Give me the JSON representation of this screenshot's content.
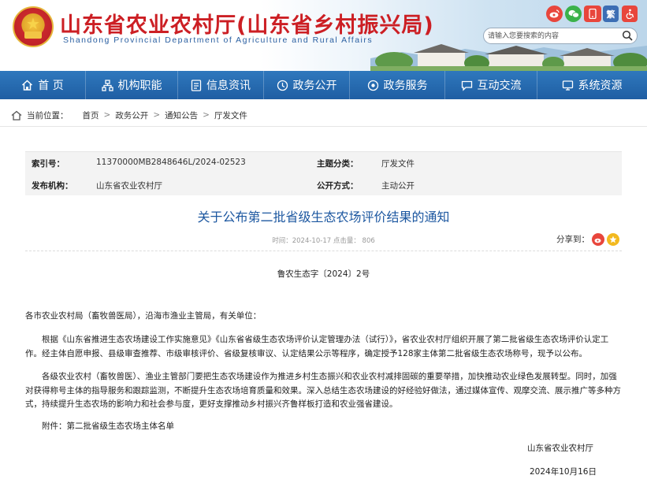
{
  "header": {
    "title_cn": "山东省农业农村厅(山东省乡村振兴局)",
    "title_en": "Shandong Provincial Department of Agriculture and Rural Affairs",
    "emblem_icon": "national-emblem-icon",
    "social": [
      {
        "name": "weibo",
        "glyph": "微"
      },
      {
        "name": "wechat",
        "glyph": "信"
      },
      {
        "name": "app",
        "glyph": "▭"
      },
      {
        "name": "simplified-traditional",
        "glyph": "繁"
      },
      {
        "name": "accessibility",
        "glyph": "♿"
      }
    ],
    "search_placeholder": "请输入您要搜索的内容"
  },
  "nav": {
    "items": [
      {
        "label": "首 页",
        "icon": "home-icon"
      },
      {
        "label": "机构职能",
        "icon": "org-icon"
      },
      {
        "label": "信息资讯",
        "icon": "document-icon"
      },
      {
        "label": "政务公开",
        "icon": "open-icon"
      },
      {
        "label": "政务服务",
        "icon": "service-icon"
      },
      {
        "label": "互动交流",
        "icon": "chat-icon"
      },
      {
        "label": "系统资源",
        "icon": "system-icon"
      }
    ],
    "color": "#2668ae"
  },
  "breadcrumb": {
    "prefix": "当前位置：",
    "items": [
      "首页",
      "政务公开",
      "通知公告",
      "厅发文件"
    ],
    "separator": ">"
  },
  "info": {
    "index_key": "索引号：",
    "index_val": "11370000MB2848646L/2024-02523",
    "category_key": "主题分类：",
    "category_val": "厅发文件",
    "issuer_key": "发布机构：",
    "issuer_val": "山东省农业农村厅",
    "mode_key": "公开方式：",
    "mode_val": "主动公开"
  },
  "article": {
    "title": "关于公布第二批省级生态农场评价结果的通知",
    "meta": "时间：2024-10-17    点击量：  806",
    "share_label": "分享到：",
    "doc_no": "鲁农生态字〔2024〕2号",
    "addressee": "各市农业农村局（畜牧兽医局），沿海市渔业主管局，有关单位：",
    "p1": "根据《山东省推进生态农场建设工作实施意见》《山东省省级生态农场评价认定管理办法（试行）》，省农业农村厅组织开展了第二批省级生态农场评价认定工作。经主体自愿申报、县级审查推荐、市级审核评价、省级复核审议、认定结果公示等程序，确定授予128家主体第二批省级生态农场称号，现予以公布。",
    "p2": "各级农业农村（畜牧兽医）、渔业主管部门要把生态农场建设作为推进乡村生态振兴和农业农村减排固碳的重要举措，加快推动农业绿色发展转型。同时，加强对获得称号主体的指导服务和跟踪监测，不断提升生态农场培育质量和效果。深入总结生态农场建设的好经验好做法，通过媒体宣传、观摩交流、展示推广等多种方式，持续提升生态农场的影响力和社会参与度，更好支撑推动乡村振兴齐鲁样板打造和农业强省建设。",
    "p3": "附件：第二批省级生态农场主体名单",
    "signature": "山东省农业农村厅",
    "date": "2024年10月16日"
  }
}
